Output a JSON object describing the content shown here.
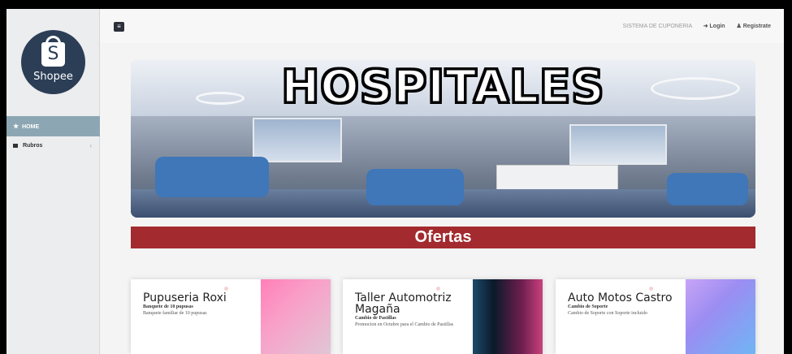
{
  "sidebar": {
    "logo_text": "Shopee",
    "logo_letter": "S",
    "items": [
      {
        "label": "HOME",
        "icon": "star-icon",
        "active": true
      },
      {
        "label": "Rubros",
        "icon": "square-icon",
        "chevron": "‹"
      }
    ]
  },
  "topbar": {
    "menu_icon": "≡",
    "system_title": "SISTEMA DE CUPONERIA",
    "login": "➜ Login",
    "register": "♟ Registrate"
  },
  "banner": {
    "title": "HOSPITALES"
  },
  "section": {
    "title": "Ofertas"
  },
  "colors": {
    "sidebar_active": "#8ca7b3",
    "ofertas_red": "#a32a2e",
    "logo_bg": "#2c3e56"
  },
  "offers": [
    {
      "title": "Pupuseria Roxi",
      "subtitle": "Banquete de 10 pupusas",
      "description": "Banquete familiar de 10 pupusas",
      "image_gradient": "linear-gradient(135deg,#ff7fb8 0%,#f9a0c8 40%,#e0c6d6 100%)"
    },
    {
      "title": "Taller Automotriz Magaña",
      "subtitle": "Cambio de Pastillas",
      "description": "Promocion en Octubre para el Cambio de Pastillas",
      "image_gradient": "linear-gradient(90deg,#1c4a6a 0%,#0b1a2a 30%,#6e1e4e 70%,#c9417e 100%)"
    },
    {
      "title": "Auto Motos Castro",
      "subtitle": "Cambio de Soporte",
      "description": "Cambio de Soporte con Soporte incluido",
      "image_gradient": "linear-gradient(135deg,#c8a4f6 0%,#9b8df2 40%,#6fb5f4 100%)"
    }
  ]
}
